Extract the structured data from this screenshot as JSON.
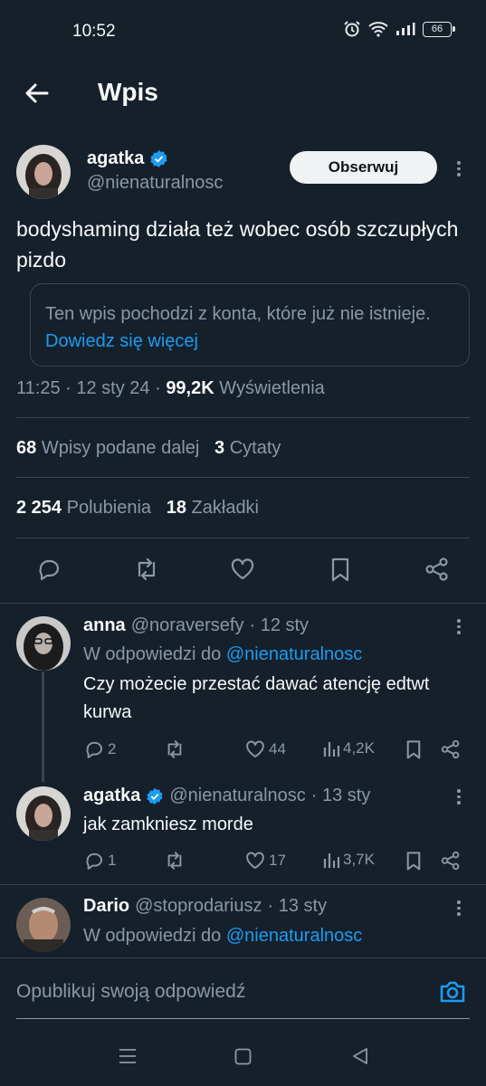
{
  "status_bar": {
    "time": "10:52",
    "battery": "66"
  },
  "header": {
    "title": "Wpis"
  },
  "main_post": {
    "name": "agatka",
    "handle": "@nienaturalnosc",
    "follow_label": "Obserwuj",
    "text": "bodyshaming działa też wobec osób szczupłych pizdo",
    "notice_text": "Ten wpis pochodzi z konta, które już nie istnieje.",
    "notice_link": "Dowiedz się więcej",
    "time": "11:25",
    "date": "12 sty 24",
    "views": "99,2K",
    "views_label": "Wyświetlenia",
    "reposts": "68",
    "reposts_label": "Wpisy podane dalej",
    "quotes": "3",
    "quotes_label": "Cytaty",
    "likes": "2 254",
    "likes_label": "Polubienia",
    "bookmarks": "18",
    "bookmarks_label": "Zakładki"
  },
  "replies": [
    {
      "name": "anna",
      "handle": "@noraversefy",
      "time": "· 12 sty",
      "reply_to_prefix": "W odpowiedzi do",
      "reply_to": "@nienaturalnosc",
      "text": "Czy możecie przestać dawać atencję edtwt kurwa",
      "replies": "2",
      "reposts": "",
      "likes": "44",
      "views": "4,2K"
    },
    {
      "name": "agatka",
      "handle": "@nienaturalnosc",
      "time": "· 13 sty",
      "text": "jak zamkniesz morde",
      "replies": "1",
      "reposts": "",
      "likes": "17",
      "views": "3,7K"
    },
    {
      "name": "Dario",
      "handle": "@stoprodariusz",
      "time": "· 13 sty",
      "reply_to_prefix": "W odpowiedzi do",
      "reply_to": "@nienaturalnosc"
    }
  ],
  "composer": {
    "placeholder": "Opublikuj swoją odpowiedź"
  },
  "colors": {
    "background": "#15202b",
    "accent": "#1d9bf0",
    "muted": "#8b98a5",
    "border": "#38444d"
  }
}
